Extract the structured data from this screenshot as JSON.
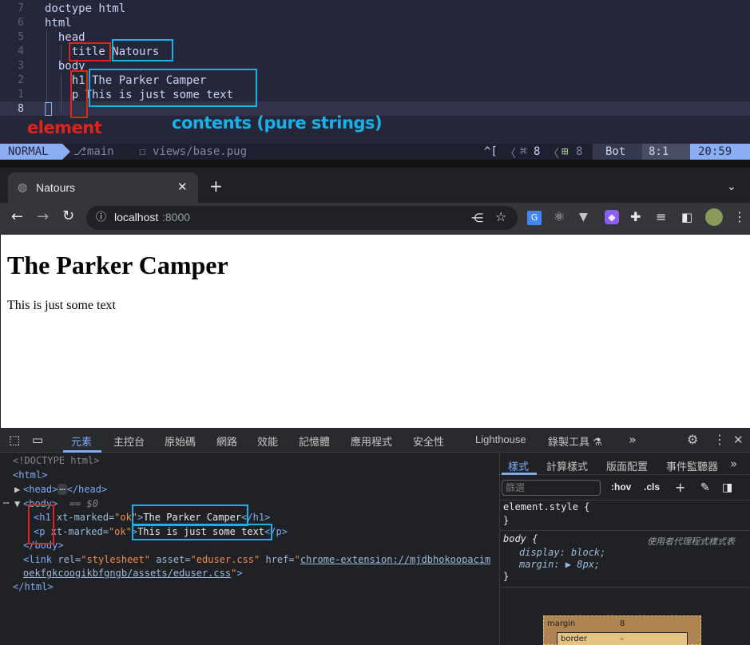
{
  "editor": {
    "lines": [
      {
        "num": "7",
        "text": "doctype html"
      },
      {
        "num": "6",
        "text": "html"
      },
      {
        "num": "5",
        "text": "  head"
      },
      {
        "num": "4",
        "text": "    title Natours"
      },
      {
        "num": "3",
        "text": "  body"
      },
      {
        "num": "2",
        "text": "    h1 The Parker Camper"
      },
      {
        "num": "1",
        "text": "    p This is just some text"
      },
      {
        "num": "8",
        "text": ""
      }
    ],
    "annotation_element": "element",
    "annotation_contents": "contents (pure strings)",
    "status": {
      "mode": "NORMAL",
      "branch": "main",
      "file": "views/base.pug",
      "keys": "^[",
      "lsp_count": "8",
      "added_count": "8",
      "position": "Bot",
      "cursor": "8:1",
      "time": "20:59"
    }
  },
  "browser": {
    "tab_title": "Natours",
    "url_host": "localhost",
    "url_port": ":8000",
    "page": {
      "heading": "The Parker Camper",
      "paragraph": "This is just some text"
    }
  },
  "devtools": {
    "tabs": [
      "元素",
      "主控台",
      "原始碼",
      "網路",
      "效能",
      "記憶體",
      "應用程式",
      "安全性",
      "Lighthouse",
      "錄製工具 ⚗"
    ],
    "dom": {
      "doctype": "<!DOCTYPE html>",
      "html_open": "<html>",
      "head": "<head>",
      "head_close": "</head>",
      "body_open": "<body>",
      "body_eq": "== $0",
      "h1_tag": "<h1",
      "h1_attr": " xt-marked=",
      "h1_attr_val": "\"ok\"",
      "h1_text": "The Parker Camper",
      "h1_close": "</h1>",
      "p_tag": "<p",
      "p_attr": " xt-marked=",
      "p_attr_val": "\"ok\"",
      "p_text": "This is just some text",
      "p_close": "</p>",
      "body_close": "</body>",
      "link_line1": "<link rel=\"stylesheet\" asset=\"eduser.css\" href=\"",
      "link_href1": "chrome-extension://mjdbhokoopacim",
      "link_href2": "oekfgkcoogikbfgngb/assets/eduser.css",
      "link_end": "\">",
      "html_close": "</html>"
    },
    "styles": {
      "tabs": [
        "樣式",
        "計算樣式",
        "版面配置",
        "事件監聽器"
      ],
      "filter_placeholder": "篩選",
      "hov": ":hov",
      "cls": ".cls",
      "element_style": "element.style {",
      "close_brace": "}",
      "body_selector": "body {",
      "ua_label": "使用者代理程式樣式表",
      "prop1": "display: block;",
      "prop2": "margin: ▶ 8px;",
      "box_margin": "margin",
      "box_margin_val": "8",
      "box_border": "border",
      "box_border_val": "–"
    }
  }
}
